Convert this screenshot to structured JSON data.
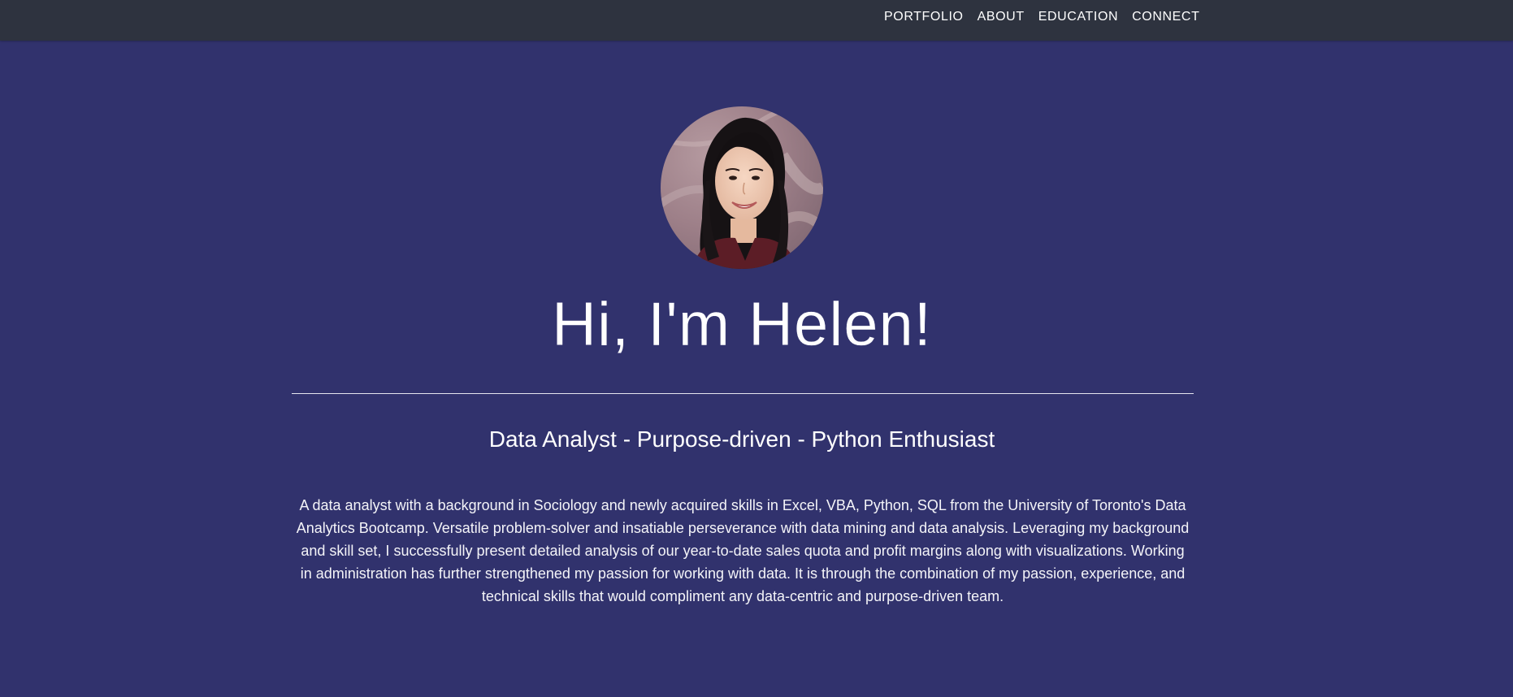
{
  "nav": {
    "items": [
      "PORTFOLIO",
      "ABOUT",
      "EDUCATION",
      "CONNECT"
    ]
  },
  "hero": {
    "avatar_alt": "Profile photo",
    "title": "Hi, I'm Helen!",
    "subtitle": "Data Analyst - Purpose-driven - Python Enthusiast",
    "bio": "A data analyst with a background in Sociology and newly acquired skills in Excel, VBA, Python, SQL from the University of Toronto's Data Analytics Bootcamp. Versatile problem-solver and insatiable perseverance with data mining and data analysis. Leveraging my background and skill set, I successfully present detailed analysis of our year-to-date sales quota and profit margins along with visualizations. Working in administration has further strengthened my passion for working with data. It is through the combination of my passion, experience, and technical skills that would compliment any data-centric and purpose-driven team."
  },
  "colors": {
    "background": "#31326d",
    "navbar": "#2e333f",
    "text": "#ffffff"
  }
}
